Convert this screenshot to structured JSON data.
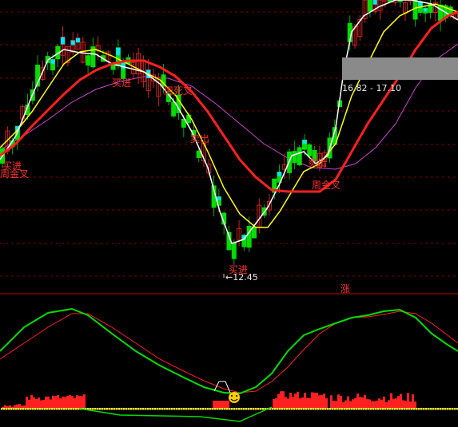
{
  "chart_data": [
    {
      "type": "candlestick",
      "panel": "main",
      "ylim": [
        11.6,
        17.9
      ],
      "price_marks": [
        {
          "text": "←12.45",
          "value": 12.45
        },
        {
          "text": "16.82 - 17.10",
          "range": [
            16.82,
            17.1
          ]
        }
      ],
      "signal_labels": [
        {
          "text": "买进",
          "bar": 1
        },
        {
          "text": "周金叉",
          "bar": 1
        },
        {
          "text": "买进",
          "bar": 24
        },
        {
          "text": "周死叉",
          "bar": 35
        },
        {
          "text": "卖出",
          "bar": 40
        },
        {
          "text": "买进",
          "bar": 48
        },
        {
          "text": "周金叉",
          "bar": 67
        },
        {
          "text": "卖出",
          "bar": 66
        }
      ],
      "badge": "涨",
      "colors": {
        "up": "#00e5ff",
        "down": "#00dd00",
        "ma_white": "#ffffff",
        "ma_yellow": "#ffff00",
        "ma_red": "#ff2020",
        "ma_magenta": "#cc44cc",
        "label": "#ff3030"
      }
    },
    {
      "type": "line",
      "panel": "indicator",
      "series_count": 2,
      "colors": {
        "fast": "#00dd00",
        "slow": "#ff2020",
        "hist": "#ff2020",
        "marker": "#ffee33"
      }
    }
  ]
}
